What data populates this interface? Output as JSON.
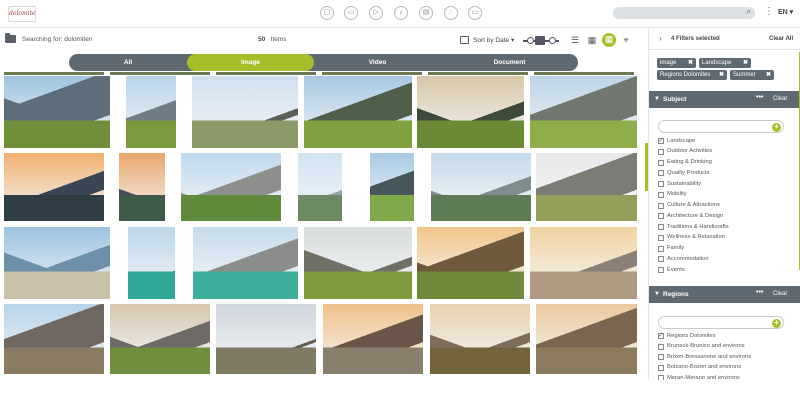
{
  "topbar": {
    "logo_text": "dolomiten",
    "icons": [
      "nav-icon-1",
      "nav-icon-2",
      "nav-icon-3",
      "nav-icon-4",
      "nav-icon-5",
      "nav-icon-6",
      "nav-icon-7"
    ],
    "language": "EN"
  },
  "header": {
    "search_label": "Searching for: dolomiten",
    "count": "50",
    "count_unit": "Items",
    "sort_label": "Sort by Date"
  },
  "tabs": [
    "All",
    "Image",
    "Video",
    "Document"
  ],
  "active_tab": "Image",
  "accent": "#a4bf2a",
  "dark": "#5f6972",
  "filters": {
    "title": "4 Filters selected",
    "clear_all": "Clear All",
    "chips": [
      "image",
      "Landscape",
      "Regions Dolomites",
      "Summer"
    ]
  },
  "subject": {
    "title": "Subject",
    "more": "•••",
    "clear": "Clear",
    "options": [
      {
        "label": "Landscape",
        "checked": true
      },
      {
        "label": "Outdoor Activities",
        "checked": false
      },
      {
        "label": "Eating & Drinking",
        "checked": false
      },
      {
        "label": "Quality Products",
        "checked": false
      },
      {
        "label": "Sustainability",
        "checked": false
      },
      {
        "label": "Mobility",
        "checked": false
      },
      {
        "label": "Culture & Attractions",
        "checked": false
      },
      {
        "label": "Architecture & Design",
        "checked": false
      },
      {
        "label": "Traditions & Handicrafts",
        "checked": false
      },
      {
        "label": "Wellness & Relaxation",
        "checked": false
      },
      {
        "label": "Family",
        "checked": false
      },
      {
        "label": "Accommodation",
        "checked": false
      },
      {
        "label": "Events",
        "checked": false
      }
    ]
  },
  "regions": {
    "title": "Regions",
    "more": "•••",
    "clear": "Clear",
    "options": [
      {
        "label": "Regions Dolomites",
        "checked": true
      },
      {
        "label": "Bruneck-Brunico and environs",
        "checked": false
      },
      {
        "label": "Brixen-Bressanone and environs",
        "checked": false
      },
      {
        "label": "Bolzano-Bozen and environs",
        "checked": false
      },
      {
        "label": "Meran-Merano and environs",
        "checked": false
      }
    ]
  }
}
